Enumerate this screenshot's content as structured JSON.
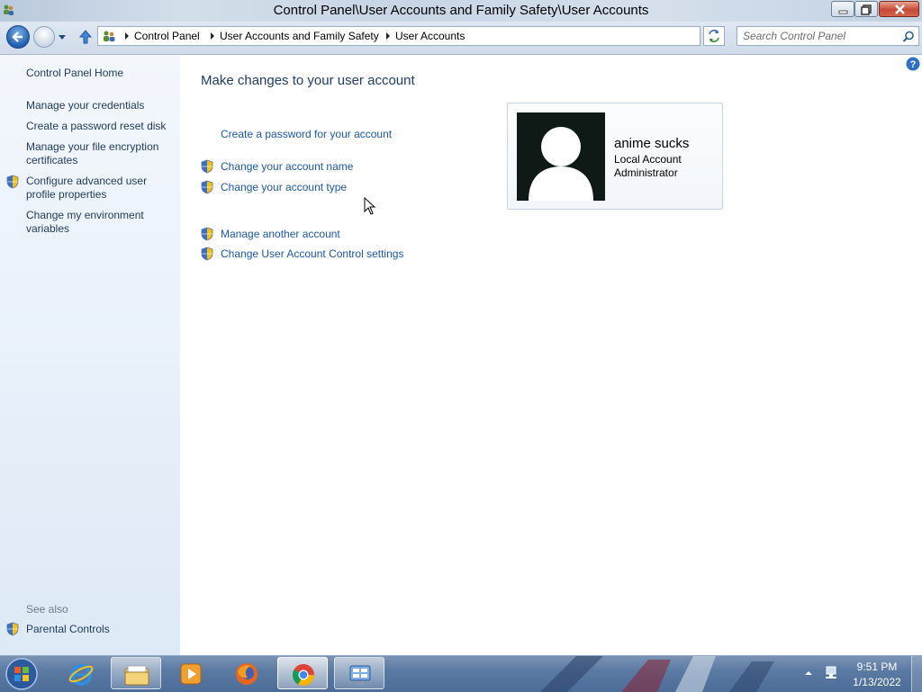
{
  "window": {
    "title": "Control Panel\\User Accounts and Family Safety\\User Accounts"
  },
  "address": {
    "breadcrumbs": [
      "Control Panel",
      "User Accounts and Family Safety",
      "User Accounts"
    ],
    "search_placeholder": "Search Control Panel"
  },
  "sidebar": {
    "home": "Control Panel Home",
    "tasks": [
      "Manage your credentials",
      "Create a password reset disk",
      "Manage your file encryption certificates",
      "Configure advanced user profile properties",
      "Change my environment variables"
    ],
    "see_also_label": "See also",
    "see_also_items": [
      "Parental Controls"
    ]
  },
  "main": {
    "title": "Make changes to your user account",
    "links": [
      "Create a password for your account",
      "Change your account name",
      "Change your account type",
      "Manage another account",
      "Change User Account Control settings"
    ]
  },
  "user": {
    "name": "anime sucks",
    "account_type": "Local Account",
    "role": "Administrator"
  },
  "taskbar": {
    "items": [
      "internet-explorer",
      "windows-explorer",
      "media-player",
      "firefox",
      "chrome",
      "control-panel"
    ],
    "time": "9:51 PM",
    "date": "1/13/2022"
  },
  "colors": {
    "link": "#1a58a8",
    "heading": "#1e3d6b",
    "sidebar_link": "#1e395b"
  }
}
